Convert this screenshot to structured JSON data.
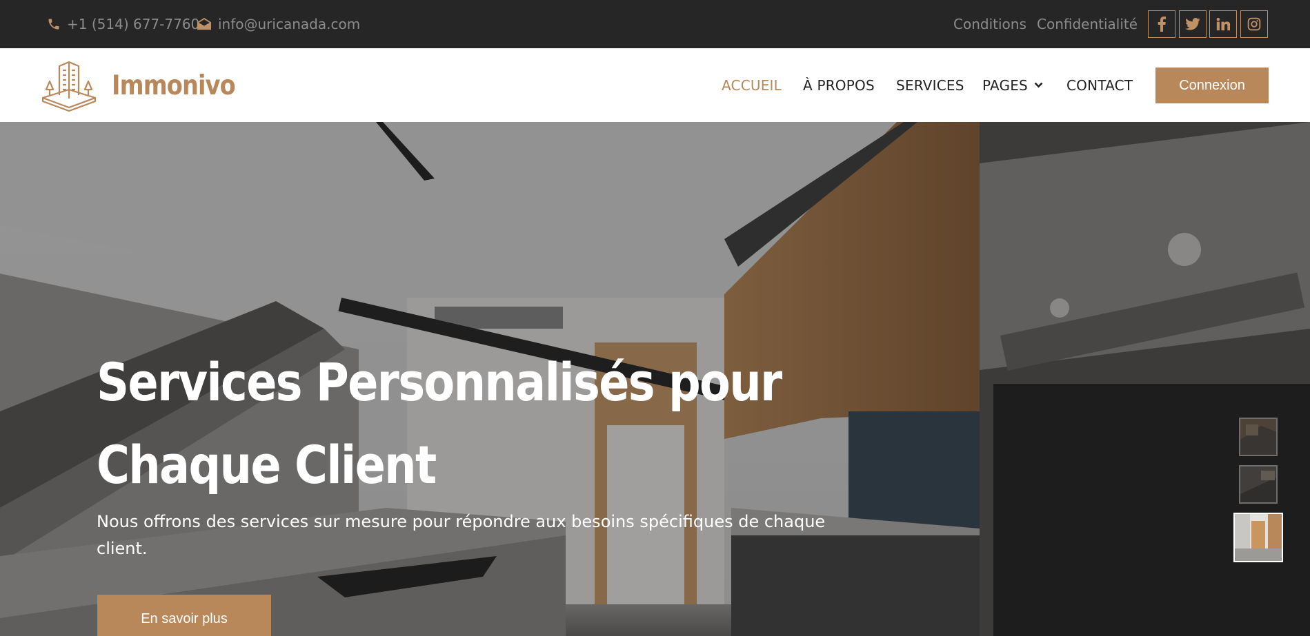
{
  "topbar": {
    "phone": "+1 (514) 677-7760",
    "email": "info@uricanada.com",
    "links": [
      "Conditions",
      "Confidentialité"
    ],
    "social_icons": [
      "facebook-icon",
      "twitter-icon",
      "linkedin-icon",
      "instagram-icon"
    ]
  },
  "navbar": {
    "brand": "Immonivo",
    "items": [
      {
        "label": "ACCUEIL",
        "active": true
      },
      {
        "label": "À PROPOS",
        "active": false
      },
      {
        "label": "SERVICES",
        "active": false
      },
      {
        "label": "PAGES",
        "active": false,
        "dropdown": true
      },
      {
        "label": "CONTACT",
        "active": false
      }
    ],
    "login_label": "Connexion"
  },
  "hero": {
    "title_line1": "Services Personnalisés pour",
    "title_line2": "Chaque Client",
    "subtitle": "Nous offrons des services sur mesure pour répondre aux besoins spécifiques de chaque client.",
    "cta_label": "En savoir plus",
    "slides": 3,
    "active_slide": 3
  },
  "colors": {
    "accent": "#b8875a",
    "topbar_bg": "#262626",
    "topbar_text": "#8c8c8c",
    "nav_text": "#222222"
  }
}
